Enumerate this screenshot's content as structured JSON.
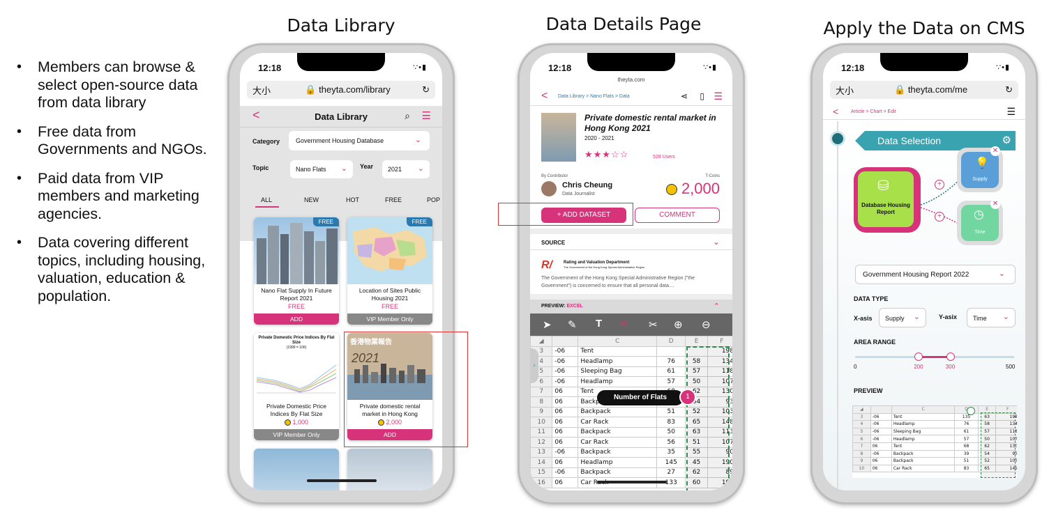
{
  "bullets": [
    "Members can browse & select open-source data from data library",
    "Free data from Governments and NGOs.",
    "Paid data from VIP members and marketing agencies.",
    "Data covering different topics, including housing, valuation, education & population."
  ],
  "titles": {
    "library": "Data Library",
    "details": "Data Details Page",
    "cms": "Apply the Data on CMS"
  },
  "status": {
    "time": "12:18",
    "icons": "∵•▮"
  },
  "phone1": {
    "lang": "大小",
    "url": "theyta.com/library",
    "back": "<",
    "header": "Data Library",
    "category_label": "Category",
    "category_value": "Government Housing Database",
    "topic_label": "Topic",
    "topic_value": "Nano Flats",
    "year_label": "Year",
    "year_value": "2021",
    "tabs": [
      "ALL",
      "NEW",
      "HOT",
      "FREE",
      "POP"
    ],
    "cards": [
      {
        "title": "Nano Flat Supply In Future Report 2021",
        "price": "FREE",
        "action": "ADD",
        "badge": "FREE"
      },
      {
        "title": "Location of Sites Public Housing 2021",
        "price": "FREE",
        "action": "VIP Member Only",
        "badge": "FREE"
      },
      {
        "title": "Private Domestic Price Indices By Flat Size",
        "price": "1,000",
        "action": "VIP Member Only",
        "chart_title": "Private Domestic Price Indices By Flat Size",
        "chart_sub": "(1999 = 100)"
      },
      {
        "title": "Private domestic rental market in Hong Kong",
        "price": "2,000",
        "action": "ADD",
        "cover_year": "2021",
        "cover_cn": "香港物業報告"
      }
    ]
  },
  "phone2": {
    "domain": "theyta.com",
    "breadcrumb": "Data Library > Nano Flats > Data",
    "title": "Private domestic rental market in Hong Kong 2021",
    "years": "2020 - 2021",
    "users": "528 Users",
    "contributor_label": "By Contributor",
    "author": "Chris Cheung",
    "role": "Data Journalist",
    "tcoins_label": "T-Coins",
    "tcoins_value": "2,000",
    "add_dataset": "+ ADD DATASET",
    "comment": "COMMENT",
    "source_label": "SOURCE",
    "source_org": "Rating and Valuation Department",
    "source_org_sub": "The Government of the Hong Kong Special Administrative Region",
    "source_text": "The Government of the Hong Kong Special Administrative Region (\"the Government\") is concerned to ensure that all personal data....",
    "preview_label": "PREVIEW:",
    "preview_type": "EXCEL",
    "col_tooltip": "Number of Flats",
    "col_badge": "1",
    "col_headers": [
      "",
      "C",
      "D",
      "E",
      "F"
    ],
    "rows": [
      [
        "3",
        "-06",
        "Tent",
        "",
        "",
        "198"
      ],
      [
        "4",
        "-06",
        "Headlamp",
        "76",
        "58",
        "134"
      ],
      [
        "5",
        "-06",
        "Sleeping Bag",
        "61",
        "57",
        "118"
      ],
      [
        "6",
        "-06",
        "Headlamp",
        "57",
        "50",
        "107"
      ],
      [
        "7",
        "06",
        "Tent",
        "68",
        "62",
        "130"
      ],
      [
        "8",
        "06",
        "Backpack",
        "39",
        "54",
        "93"
      ],
      [
        "9",
        "06",
        "Backpack",
        "51",
        "52",
        "103"
      ],
      [
        "10",
        "06",
        "Car Rack",
        "83",
        "65",
        "148"
      ],
      [
        "11",
        "06",
        "Backpack",
        "50",
        "63",
        "113"
      ],
      [
        "12",
        "06",
        "Car Rack",
        "56",
        "51",
        "107"
      ],
      [
        "13",
        "-06",
        "Backpack",
        "35",
        "55",
        "90"
      ],
      [
        "14",
        "06",
        "Headlamp",
        "145",
        "45",
        "190"
      ],
      [
        "15",
        "-06",
        "Backpack",
        "27",
        "62",
        "89"
      ],
      [
        "16",
        "06",
        "Car Rack",
        "133",
        "60",
        "193"
      ]
    ]
  },
  "phone3": {
    "lang": "大小",
    "url": "theyta.com/me",
    "breadcrumb": "Article > Chart > Edit",
    "header": "Data Selection",
    "db_label": "Database Housing Report",
    "supply_label": "Supply",
    "time_label": "Time",
    "dropdown": "Government Housing Report 2022",
    "data_type_label": "DATA TYPE",
    "xaxis_label": "X-asis",
    "xaxis_value": "Supply",
    "yaxis_label": "Y-asix",
    "yaxis_value": "Time",
    "area_range_label": "AREA RANGE",
    "range_min": "0",
    "range_low": "200",
    "range_high": "300",
    "range_max": "500",
    "range_low_frac": 0.4,
    "range_high_frac": 0.6,
    "preview_label": "PREVIEW",
    "col_headers": [
      "",
      "C",
      "D",
      "E",
      "F"
    ],
    "rows": [
      [
        "3",
        "-06",
        "Tent",
        "135",
        "63",
        "198"
      ],
      [
        "4",
        "-06",
        "Headlamp",
        "76",
        "58",
        "134"
      ],
      [
        "5",
        "-06",
        "Sleeping Bag",
        "61",
        "57",
        "118"
      ],
      [
        "6",
        "-06",
        "Headlamp",
        "57",
        "50",
        "107"
      ],
      [
        "7",
        "06",
        "Tent",
        "68",
        "62",
        "130"
      ],
      [
        "8",
        "-06",
        "Backpack",
        "39",
        "54",
        "93"
      ],
      [
        "9",
        "06",
        "Backpack",
        "51",
        "52",
        "103"
      ],
      [
        "10",
        "06",
        "Car Rack",
        "83",
        "65",
        "149"
      ]
    ]
  },
  "colors": {
    "accent": "#d6337a",
    "teal": "#3aa3b0",
    "green": "#a8e04a",
    "blue": "#5a9fd8",
    "mint": "#72d6a0"
  }
}
